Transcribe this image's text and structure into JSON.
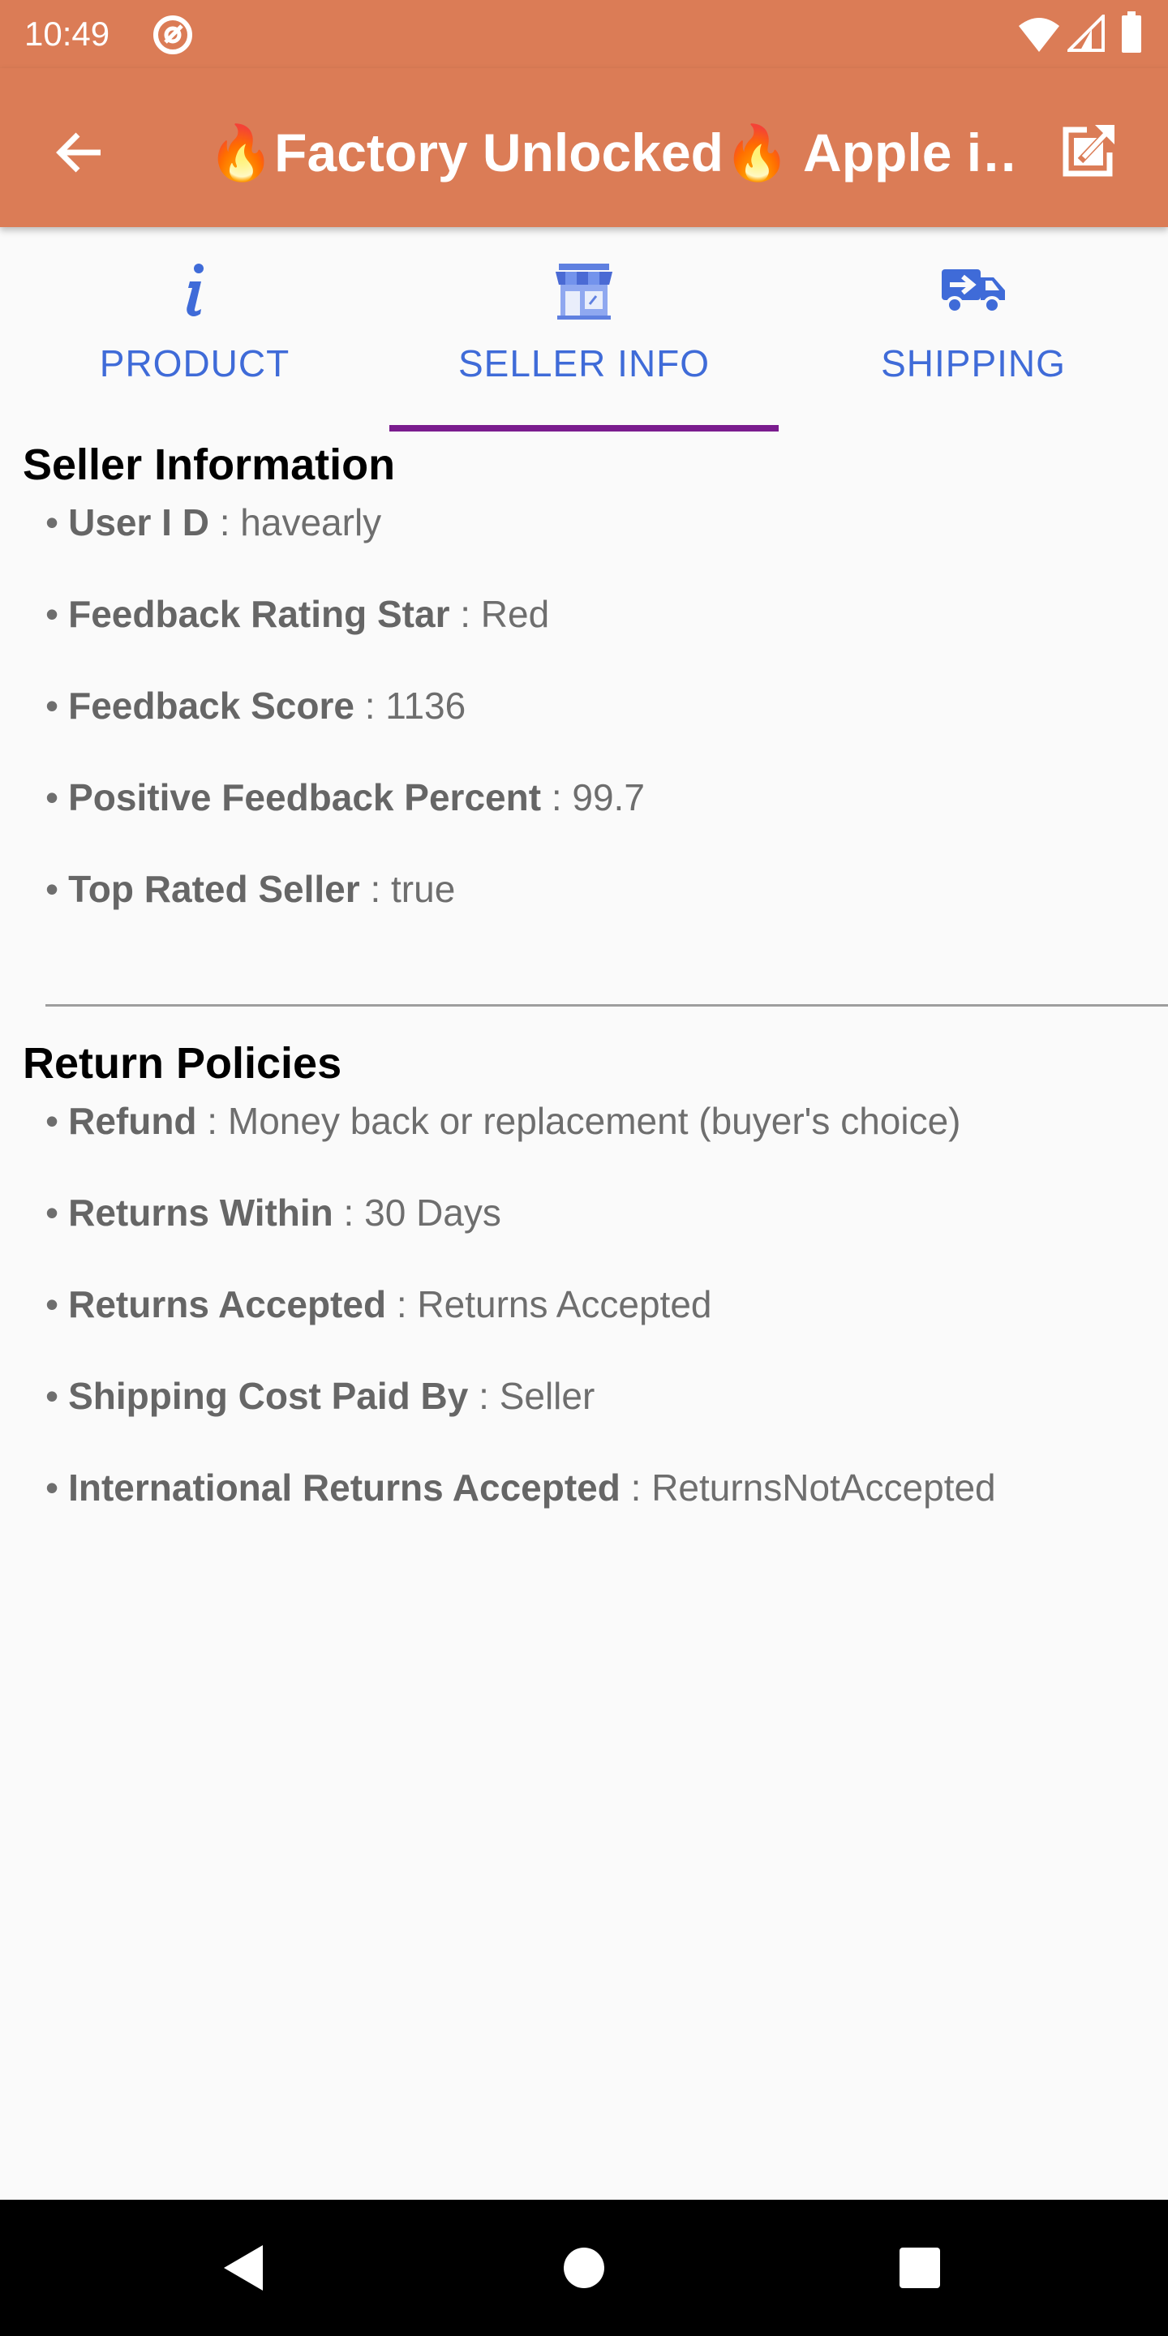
{
  "status_bar": {
    "time": "10:49"
  },
  "app_bar": {
    "title": "🔥Factory Unlocked🔥 Apple i…"
  },
  "tabs": [
    {
      "label": "PRODUCT",
      "icon": "info-icon"
    },
    {
      "label": "SELLER INFO",
      "icon": "store-icon"
    },
    {
      "label": "SHIPPING",
      "icon": "truck-icon"
    }
  ],
  "selected_tab": "SELLER INFO",
  "seller_information": {
    "title": "Seller Information",
    "items": [
      {
        "key": "User I D",
        "value": " : havearly"
      },
      {
        "key": "Feedback Rating Star",
        "value": " : Red"
      },
      {
        "key": "Feedback Score",
        "value": " : 1136"
      },
      {
        "key": "Positive Feedback Percent",
        "value": " : 99.7"
      },
      {
        "key": "Top Rated Seller",
        "value": " : true"
      }
    ]
  },
  "return_policies": {
    "title": "Return Policies",
    "items": [
      {
        "key": "Refund",
        "value": " : Money back or replacement (buyer's choice)"
      },
      {
        "key": "Returns Within",
        "value": " : 30 Days"
      },
      {
        "key": "Returns Accepted",
        "value": " : Returns Accepted"
      },
      {
        "key": "Shipping Cost Paid By",
        "value": " : Seller"
      },
      {
        "key": "International Returns Accepted",
        "value": " : ReturnsNotAccepted"
      }
    ]
  },
  "colors": {
    "app_bar": "#DB7C56",
    "tab_text": "#3F6BD8",
    "tab_indicator": "#7A1C8E",
    "background": "#FAFAFA"
  }
}
